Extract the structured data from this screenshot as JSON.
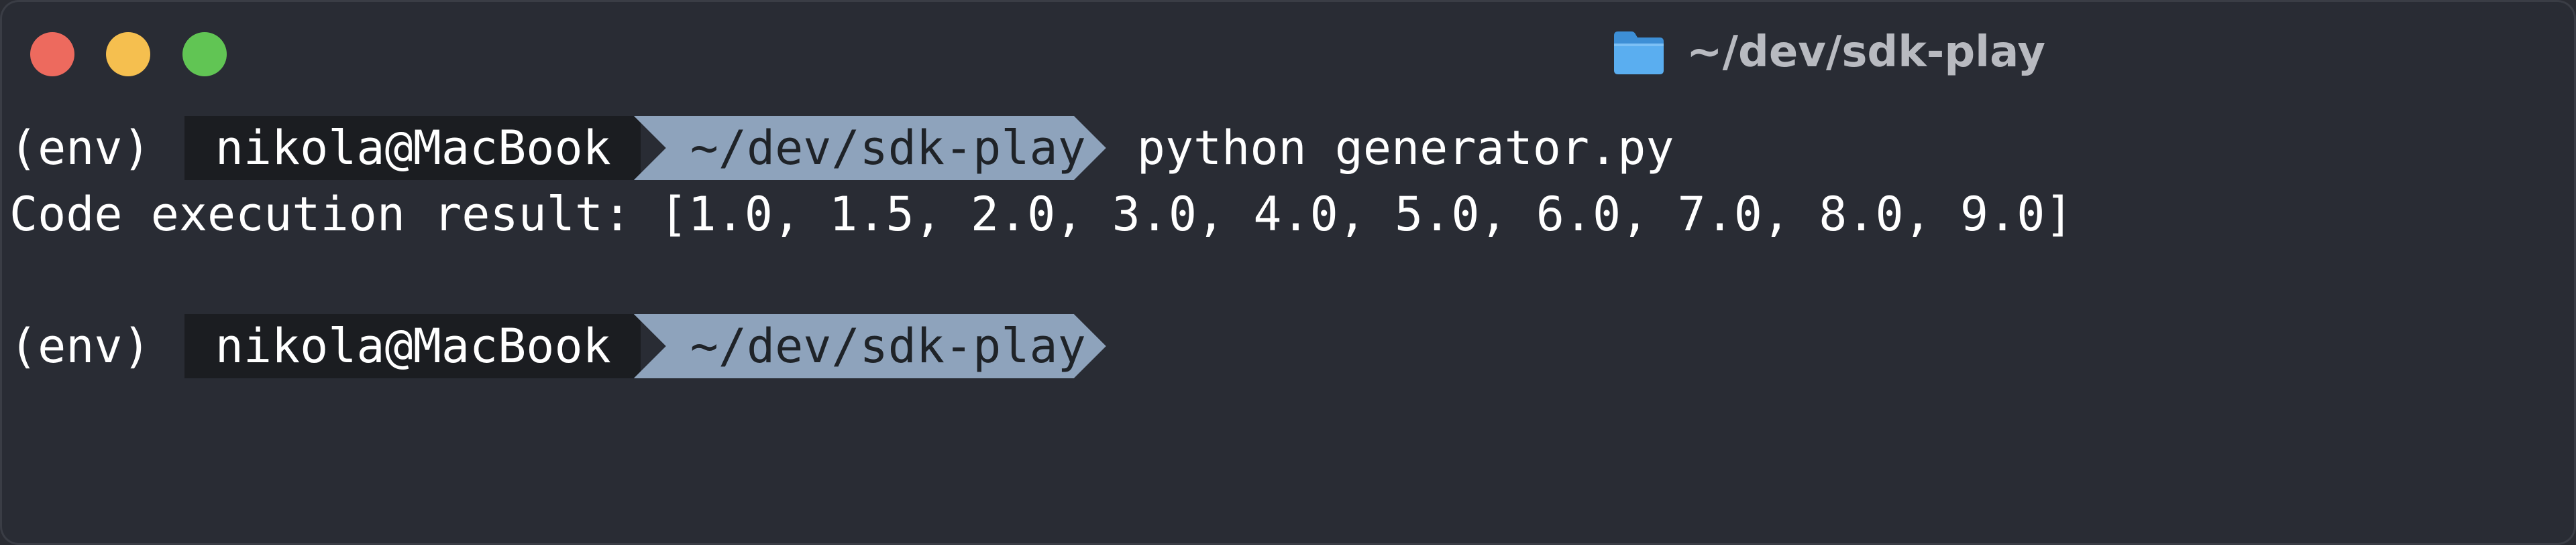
{
  "window": {
    "title": "~/dev/sdk-play",
    "title_icon": "folder-icon",
    "buttons": {
      "close_color": "#ed6a5e",
      "minimize_color": "#f5bf4f",
      "zoom_color": "#61c554"
    }
  },
  "terminal": {
    "lines": [
      {
        "env": "(env)",
        "user": "nikola@MacBook",
        "path": "~/dev/sdk-play",
        "command": "python generator.py"
      },
      {
        "output": "Code execution result: [1.0, 1.5, 2.0, 3.0, 4.0, 5.0, 6.0, 7.0, 8.0, 9.0]"
      },
      {
        "env": "(env)",
        "user": "nikola@MacBook",
        "path": "~/dev/sdk-play",
        "command": ""
      }
    ]
  },
  "colors": {
    "background": "#292c34",
    "prompt_user_bg": "#1b1d21",
    "prompt_path_bg": "#8ea3bc",
    "text": "#ffffff"
  }
}
